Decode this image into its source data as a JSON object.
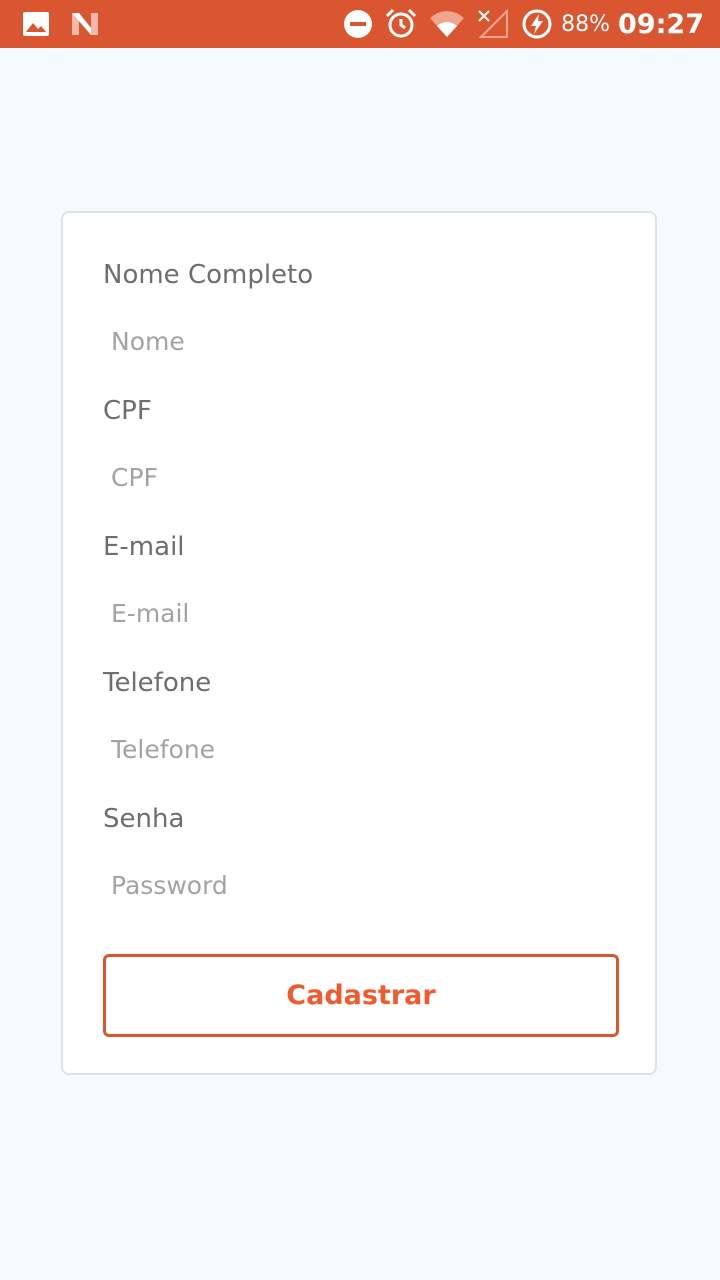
{
  "status_bar": {
    "background": "#DA5631",
    "left_icons": [
      "image-icon",
      "n-logo-icon"
    ],
    "right_icons": [
      "do-not-disturb-icon",
      "alarm-icon",
      "wifi-icon",
      "no-signal-icon",
      "battery-charging-icon"
    ],
    "battery_percent": "88%",
    "time": "09:27"
  },
  "form": {
    "fields": [
      {
        "label": "Nome Completo",
        "placeholder": "Nome"
      },
      {
        "label": "CPF",
        "placeholder": "CPF"
      },
      {
        "label": "E-mail",
        "placeholder": "E-mail"
      },
      {
        "label": "Telefone",
        "placeholder": "Telefone"
      },
      {
        "label": "Senha",
        "placeholder": "Password"
      }
    ],
    "submit_label": "Cadastrar"
  },
  "colors": {
    "accent": "#DA5631",
    "button_text": "#EF5A2F",
    "page_background": "#F4FAFE",
    "card_border": "#DCE3E8"
  }
}
